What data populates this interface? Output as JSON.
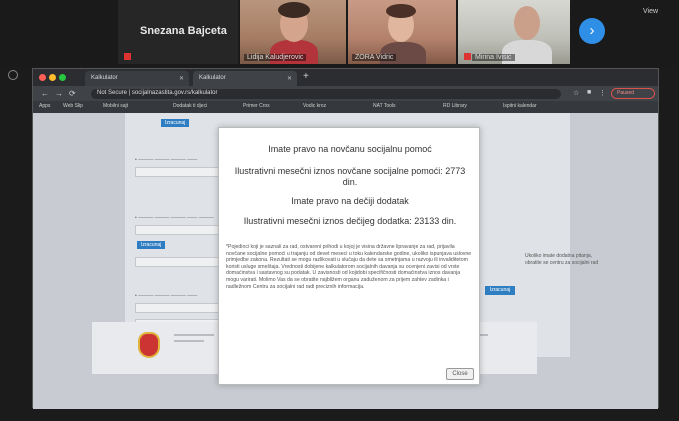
{
  "zoom": {
    "participants": [
      {
        "name": "Snezana Bajceta",
        "video": false
      },
      {
        "name": "Lidija Kaludjerovic",
        "video": true
      },
      {
        "name": "ZORA Vidric",
        "video": true
      },
      {
        "name": "Mirina Ivisic",
        "video": true
      }
    ],
    "next_icon": "chevron-right-icon",
    "view_label": "View"
  },
  "browser": {
    "tabs": [
      {
        "label": "Kalkulator"
      },
      {
        "label": "Kalkulator"
      }
    ],
    "url": "Not Secure | socijalnazastita.gov.rs/kalkulator",
    "profile_label": "Paused",
    "bookmarks": [
      "Apps",
      "Web Slip",
      "Mobilni sajt",
      "Dodatak ti djeci",
      "Primer Cros",
      "Vodic kroz",
      "NAT Tools",
      "RD Library",
      "Ispitni kalendar"
    ]
  },
  "page": {
    "button_top": "Izracunaj",
    "button_mid": "Izracunaj",
    "button_bottom": "Izracunaj",
    "sidenote": "Ukoliko imate dodatna pitanja, obratite se centru za socijalni rad"
  },
  "modal": {
    "heading1": "Imate pravo na novčanu socijalnu pomoć",
    "amount1": "Ilustrativni mesečni iznos novčane socijalne pomoći: 2773 din.",
    "heading2": "Imate pravo na dečiji dodatak",
    "amount2": "Ilustrativni mesečni iznos dečijeg dodatka: 23133 din.",
    "note": "*Pojedinci koji je saznali za rad, ostvareni prihodi u kojoj je visina državne lipravanje za rad, prijavila novčane socijalne pomoći u trajanju od devet meseci u toku kalendarske godine, ukoliko ispunjava uslovne primjedbe zakona. Rezultati se mogu razlikovati u slučaju da dete sa smetnjama u razvoju ili invaliditetom koristi usluge smeštaja. Vrednosti dobijene kalkulatorom socijalnih davanja su ocenjeni zavisi od vrste domaćinstva i sastavnog su podatak. U zavisnosti od kojidobi specifičnosti domaćinstva iznos davanja mogu varirati. Molimo Vas da se obratite najbližem organu zaduženom za prijem zahtev zadinka i nadležnom Centru za socijalni rad radi preciznih informacija.",
    "close_label": "Close"
  }
}
